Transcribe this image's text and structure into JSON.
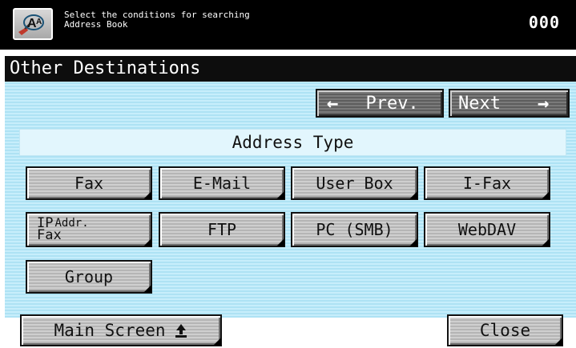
{
  "header": {
    "message_line1": "Select the conditions for searching",
    "message_line2": "Address Book",
    "counter": "000"
  },
  "title": "Other Destinations",
  "nav": {
    "prev_label": "Prev.",
    "next_label": "Next",
    "prev_arrow": "←",
    "next_arrow": "→"
  },
  "section_header": "Address Type",
  "address_types": {
    "fax": "Fax",
    "email": "E-Mail",
    "user_box": "User Box",
    "ifax": "I-Fax",
    "ip_fax_top": "IP",
    "ip_fax_sup": "Addr.",
    "ip_fax_bottom": "Fax",
    "ftp": "FTP",
    "pc_smb": "PC (SMB)",
    "webdav": "WebDAV",
    "group": "Group"
  },
  "footer": {
    "main_screen": "Main Screen",
    "close": "Close"
  },
  "colors": {
    "panel_blue": "#aee2f4",
    "title_bg": "#0d0d0d",
    "button_gray": "#c4c4c4",
    "nav_dark_gray": "#6b6b6b"
  }
}
